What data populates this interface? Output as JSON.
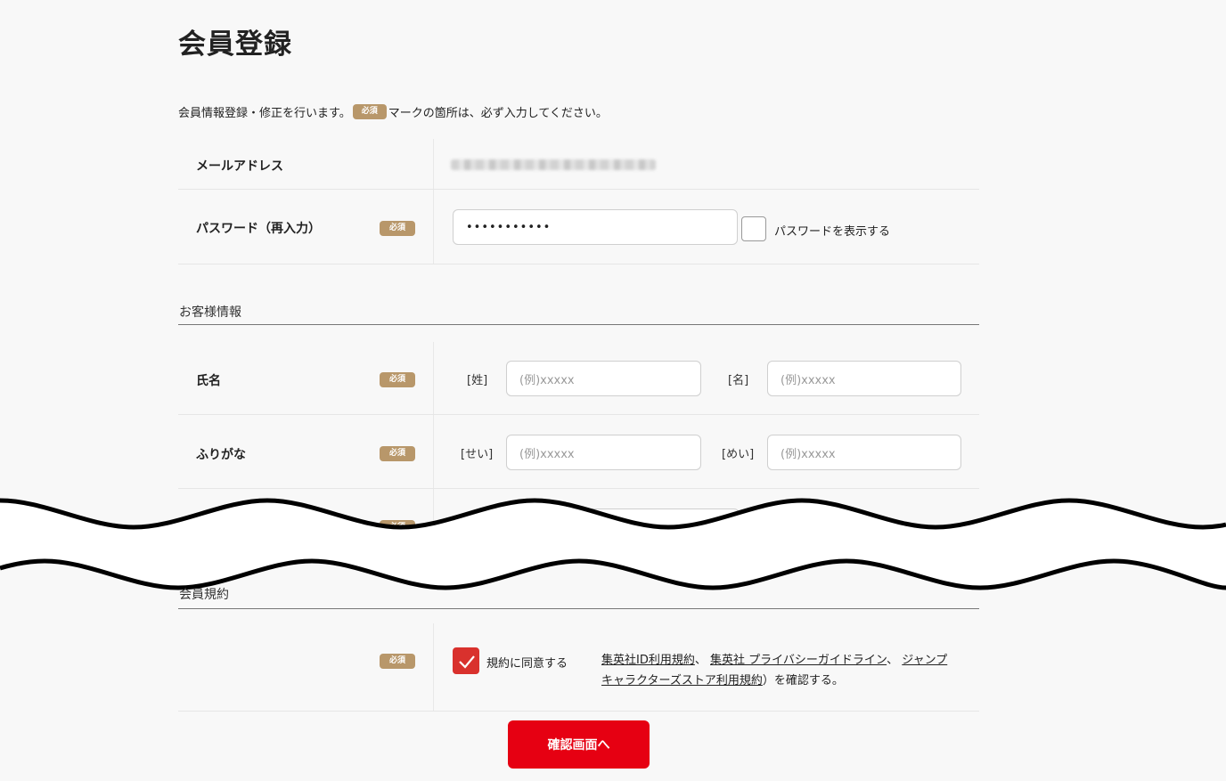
{
  "page": {
    "title": "会員登録",
    "intro_before": "会員情報登録・修正を行います。",
    "intro_after": "マークの箇所は、必ず入力してください。",
    "required_badge": "必須"
  },
  "account": {
    "email_label": "メールアドレス",
    "password_label": "パスワード（再入力）",
    "password_value": "•••••••••••",
    "show_password_label": "パスワードを表示する"
  },
  "customer": {
    "section_title": "お客様情報",
    "name_label": "氏名",
    "last_name_prefix": "[姓]",
    "first_name_prefix": "[名]",
    "last_name_placeholder": "(例)xxxxx",
    "first_name_placeholder": "(例)xxxxx",
    "furigana_label": "ふりがな",
    "last_kana_prefix": "[せい]",
    "first_kana_prefix": "[めい]",
    "last_kana_placeholder": "(例)xxxxx",
    "first_kana_placeholder": "(例)xxxxx"
  },
  "terms": {
    "section_title": "会員規約",
    "agree_label": "規約に同意する",
    "agree_checked": true,
    "link_1": "集英社ID利用規約",
    "sep_1": "、",
    "link_2": "集英社 プライバシーガイドライン",
    "sep_2": "、",
    "link_3": "ジャンプキャラクターズストア利用規約",
    "suffix": "）を確認する。"
  },
  "submit_label": "確認画面へ",
  "colors": {
    "accent_red": "#e60012",
    "checkbox_red": "#d9312d",
    "badge_gold": "#b8976a",
    "background": "#f8f8f8"
  }
}
